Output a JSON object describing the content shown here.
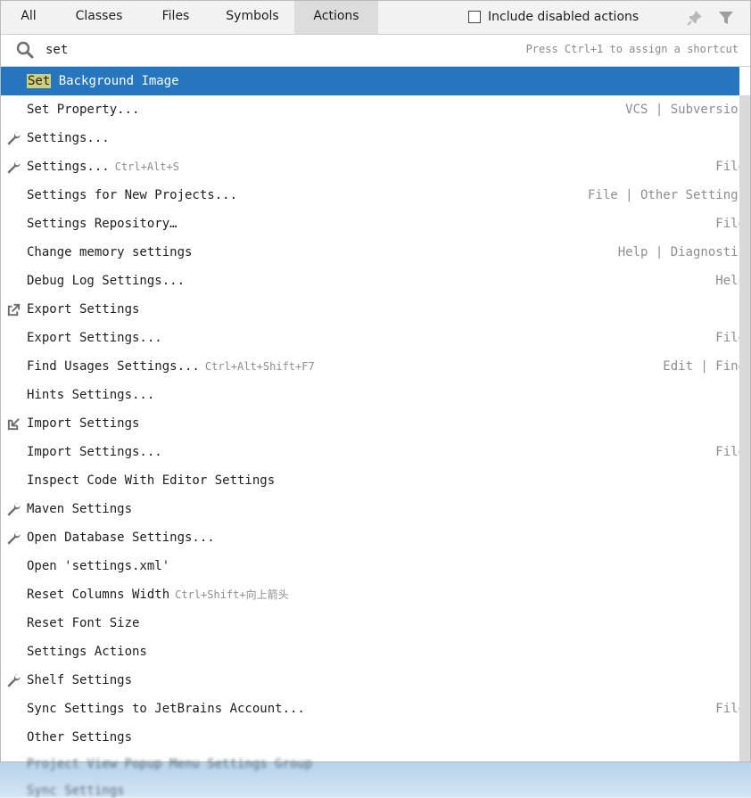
{
  "tabs": [
    {
      "label": "All"
    },
    {
      "label": "Classes"
    },
    {
      "label": "Files"
    },
    {
      "label": "Symbols"
    },
    {
      "label": "Actions"
    }
  ],
  "active_tab": "Actions",
  "options": {
    "include_disabled_label": "Include disabled actions",
    "include_disabled_checked": false
  },
  "header_icons": [
    "pin-icon",
    "filter-icon"
  ],
  "search": {
    "value": "set",
    "hint": "Press Ctrl+1 to assign a shortcut"
  },
  "results": [
    {
      "icon": "",
      "highlight": "Set",
      "rest": " Background Image",
      "shortcut": "",
      "location": "",
      "selected": true
    },
    {
      "icon": "",
      "highlight": "",
      "rest": "Set Property...",
      "shortcut": "",
      "location": "VCS | Subversion"
    },
    {
      "icon": "wrench-icon",
      "highlight": "",
      "rest": "Settings...",
      "shortcut": "",
      "location": ""
    },
    {
      "icon": "wrench-icon",
      "highlight": "",
      "rest": "Settings...",
      "shortcut": "Ctrl+Alt+S",
      "location": "File"
    },
    {
      "icon": "",
      "highlight": "",
      "rest": "Settings for New Projects...",
      "shortcut": "",
      "location": "File | Other Settings"
    },
    {
      "icon": "",
      "highlight": "",
      "rest": "Settings Repository…",
      "shortcut": "",
      "location": "File"
    },
    {
      "icon": "",
      "highlight": "",
      "rest": "Change memory settings",
      "shortcut": "",
      "location": "Help | Diagnostic"
    },
    {
      "icon": "",
      "highlight": "",
      "rest": "Debug Log Settings...",
      "shortcut": "",
      "location": "Help"
    },
    {
      "icon": "export-icon",
      "highlight": "",
      "rest": "Export Settings",
      "shortcut": "",
      "location": ""
    },
    {
      "icon": "",
      "highlight": "",
      "rest": "Export Settings...",
      "shortcut": "",
      "location": "File"
    },
    {
      "icon": "",
      "highlight": "",
      "rest": "Find Usages Settings...",
      "shortcut": "Ctrl+Alt+Shift+F7",
      "location": "Edit | Find"
    },
    {
      "icon": "",
      "highlight": "",
      "rest": "Hints Settings...",
      "shortcut": "",
      "location": ""
    },
    {
      "icon": "import-icon",
      "highlight": "",
      "rest": "Import Settings",
      "shortcut": "",
      "location": ""
    },
    {
      "icon": "",
      "highlight": "",
      "rest": "Import Settings...",
      "shortcut": "",
      "location": "File"
    },
    {
      "icon": "",
      "highlight": "",
      "rest": "Inspect Code With Editor Settings",
      "shortcut": "",
      "location": ""
    },
    {
      "icon": "wrench-icon",
      "highlight": "",
      "rest": "Maven Settings",
      "shortcut": "",
      "location": ""
    },
    {
      "icon": "wrench-icon",
      "highlight": "",
      "rest": "Open Database Settings...",
      "shortcut": "",
      "location": ""
    },
    {
      "icon": "",
      "highlight": "",
      "rest": "Open 'settings.xml'",
      "shortcut": "",
      "location": ""
    },
    {
      "icon": "",
      "highlight": "",
      "rest": "Reset Columns Width",
      "shortcut": "Ctrl+Shift+向上箭头",
      "location": ""
    },
    {
      "icon": "",
      "highlight": "",
      "rest": "Reset Font Size",
      "shortcut": "",
      "location": ""
    },
    {
      "icon": "",
      "highlight": "",
      "rest": "Settings Actions",
      "shortcut": "",
      "location": ""
    },
    {
      "icon": "wrench-icon",
      "highlight": "",
      "rest": "Shelf Settings",
      "shortcut": "",
      "location": ""
    },
    {
      "icon": "",
      "highlight": "",
      "rest": "Sync Settings to JetBrains Account...",
      "shortcut": "",
      "location": "File"
    },
    {
      "icon": "",
      "highlight": "",
      "rest": "Other Settings",
      "shortcut": "",
      "location": ""
    }
  ],
  "background_text": [
    "Project View Popup Menu Settings Group",
    "Sync Settings"
  ],
  "colors": {
    "selection": "#2675bf",
    "highlight": "#cfcf7a",
    "secondary_text": "#8e8e8e"
  }
}
